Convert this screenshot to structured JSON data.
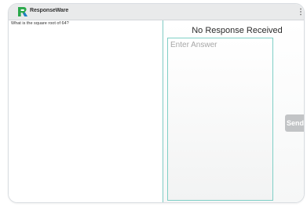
{
  "app": {
    "title": "ResponseWare",
    "logo_icon": "responseware-r-logo-icon",
    "menu_icon": "overflow-menu-icon",
    "brand_colors": [
      "#2aa84a",
      "#1e7fc8"
    ]
  },
  "question": {
    "text": "What is the square root of 64?"
  },
  "response": {
    "status": "No Response Received",
    "answer_placeholder": "Enter Answer",
    "answer_value": "",
    "send_label": "Send",
    "accent_color": "#80cbc4"
  }
}
